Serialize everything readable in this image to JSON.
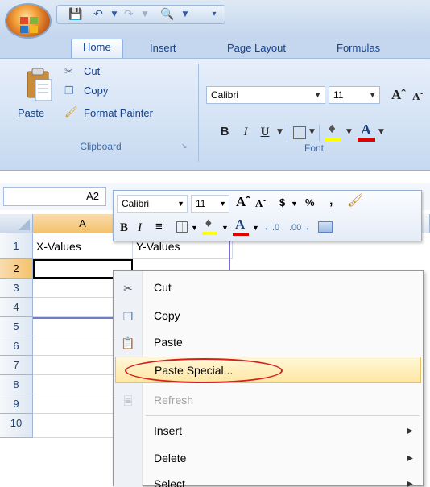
{
  "ribbon_tabs": [
    "Home",
    "Insert",
    "Page Layout",
    "Formulas"
  ],
  "clipboard": {
    "paste_label": "Paste",
    "cut_label": "Cut",
    "copy_label": "Copy",
    "format_painter_label": "Format Painter",
    "group_label": "Clipboard"
  },
  "font_group": {
    "font_name": "Calibri",
    "font_size": "11",
    "group_label": "Font"
  },
  "name_box": "A2",
  "columns": [
    "A"
  ],
  "rows": [
    "1",
    "2",
    "3",
    "4",
    "5",
    "6",
    "7",
    "8",
    "9",
    "10"
  ],
  "cells": {
    "a1": "X-Values",
    "b1": "Y-Values"
  },
  "mini_toolbar": {
    "font_name": "Calibri",
    "font_size": "11",
    "currency": "$",
    "percent": "%",
    "comma": ","
  },
  "context_menu": [
    {
      "label": "Cut",
      "icon": "scissors-icon",
      "enabled": true
    },
    {
      "label": "Copy",
      "icon": "copy-icon",
      "enabled": true
    },
    {
      "label": "Paste",
      "icon": "paste-icon",
      "enabled": true
    },
    {
      "label": "Paste Special...",
      "icon": "",
      "enabled": true,
      "highlighted": true
    },
    {
      "label": "Refresh",
      "icon": "refresh-icon",
      "enabled": false
    },
    {
      "label": "Insert",
      "icon": "",
      "enabled": true,
      "submenu": true
    },
    {
      "label": "Delete",
      "icon": "",
      "enabled": true,
      "submenu": true
    },
    {
      "label": "Select",
      "icon": "",
      "enabled": true,
      "submenu": true
    }
  ],
  "colors": {
    "ribbon_text": "#15428b",
    "highlight_ring": "#d62020",
    "menu_highlight": "#ffe7a2"
  }
}
